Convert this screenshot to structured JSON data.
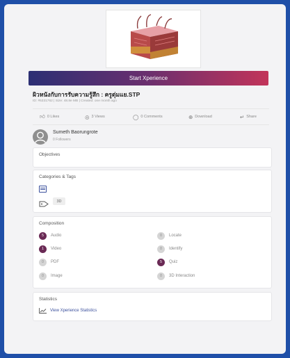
{
  "actions": [
    {
      "icon": "like-icon",
      "label": "0 Likes"
    },
    {
      "icon": "views-icon",
      "label": "3 Views"
    },
    {
      "icon": "comments-icon",
      "label": "0 Comments"
    },
    {
      "icon": "download-icon",
      "label": "Download"
    },
    {
      "icon": "share-icon",
      "label": "Share"
    }
  ],
  "title": "ผิวหนังกับการรับความรู้สึก : ครูตุ่มแย.STP",
  "meta": "ID: #5331762 | Size: 48.8e MB | Created: one month ago",
  "start_button": "Start Xperience",
  "author": {
    "name": "Sumeth Baorungrote",
    "followers": "0 Followers"
  },
  "objectives": {
    "title": "Objectives"
  },
  "categories": {
    "title": "Categories & Tags",
    "tag": "3D"
  },
  "composition": {
    "title": "Composition",
    "items": [
      {
        "count": "5",
        "label": "Audio",
        "active": true
      },
      {
        "count": "0",
        "label": "Locate",
        "active": false
      },
      {
        "count": "1",
        "label": "Video",
        "active": true
      },
      {
        "count": "0",
        "label": "Identify",
        "active": false
      },
      {
        "count": "0",
        "label": "PDF",
        "active": false
      },
      {
        "count": "5",
        "label": "Quiz",
        "active": true
      },
      {
        "count": "0",
        "label": "Image",
        "active": false
      },
      {
        "count": "0",
        "label": "3D Interaction",
        "active": false
      }
    ]
  },
  "statistics": {
    "title": "Statistics",
    "link": "View Xperience Statistics"
  },
  "colors": {
    "brand_start": "#2c2f74",
    "brand_end": "#c2345a",
    "active_badge": "#6a2a55"
  }
}
